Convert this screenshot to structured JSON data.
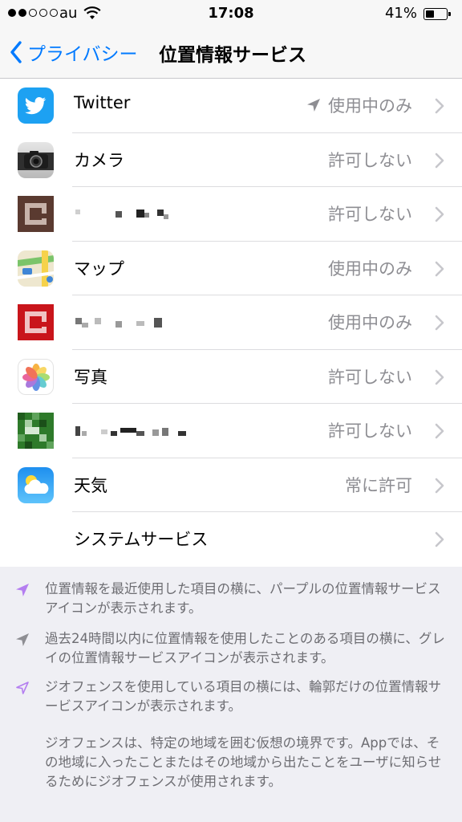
{
  "status_bar": {
    "carrier": "au",
    "time": "17:08",
    "battery": "41%",
    "battery_level": 0.41
  },
  "nav": {
    "back_label": "プライバシー",
    "title": "位置情報サービス"
  },
  "rows": [
    {
      "label": "Twitter",
      "value": "使用中のみ",
      "icon": "twitter-icon",
      "location_arrow": true
    },
    {
      "label": "カメラ",
      "value": "許可しない",
      "icon": "camera-icon"
    },
    {
      "label": "",
      "value": "許可しない",
      "icon": "pixelated-app-icon",
      "label_obscured": true
    },
    {
      "label": "マップ",
      "value": "使用中のみ",
      "icon": "maps-icon"
    },
    {
      "label": "",
      "value": "使用中のみ",
      "icon": "pixelated-app-icon",
      "label_obscured": true
    },
    {
      "label": "写真",
      "value": "許可しない",
      "icon": "photos-icon"
    },
    {
      "label": "",
      "value": "許可しない",
      "icon": "pixelated-app-icon",
      "label_obscured": true
    },
    {
      "label": "天気",
      "value": "常に許可",
      "icon": "weather-icon"
    },
    {
      "label": "システムサービス",
      "value": "",
      "icon": ""
    }
  ],
  "footer": {
    "notes": [
      {
        "icon": "purple-location-arrow-icon",
        "text": "位置情報を最近使用した項目の横に、パープルの位置情報サービスアイコンが表示されます。"
      },
      {
        "icon": "gray-location-arrow-icon",
        "text": "過去24時間以内に位置情報を使用したことのある項目の横に、グレイの位置情報サービスアイコンが表示されます。"
      },
      {
        "icon": "outline-location-arrow-icon",
        "text": "ジオフェンスを使用している項目の横には、輪郭だけの位置情報サービスアイコンが表示されます。"
      },
      {
        "icon": "",
        "text": "ジオフェンスは、特定の地域を囲む仮想の境界です。Appでは、その地域に入ったことまたはその地域から出たことをユーザに知らせるためにジオフェンスが使用されます。"
      }
    ]
  },
  "colors": {
    "accent": "#007aff",
    "purple_arrow": "#b47ef0",
    "gray_arrow": "#8e8e93"
  }
}
